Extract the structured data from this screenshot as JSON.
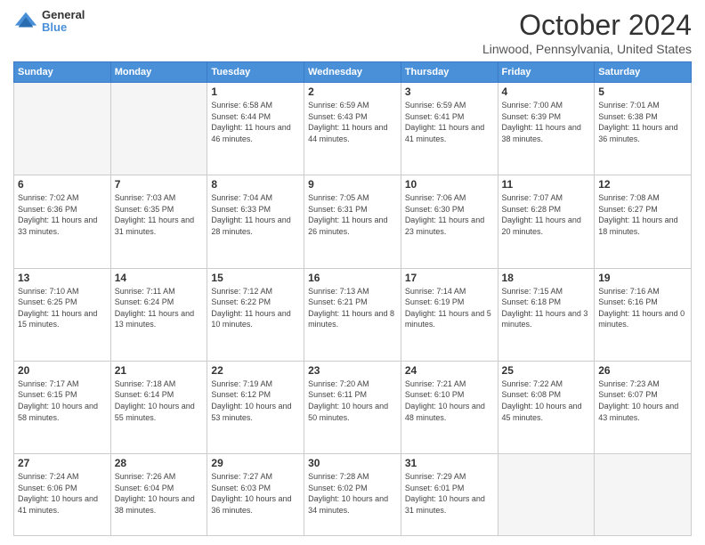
{
  "header": {
    "logo_general": "General",
    "logo_blue": "Blue",
    "title": "October 2024",
    "location": "Linwood, Pennsylvania, United States"
  },
  "weekdays": [
    "Sunday",
    "Monday",
    "Tuesday",
    "Wednesday",
    "Thursday",
    "Friday",
    "Saturday"
  ],
  "weeks": [
    [
      {
        "day": "",
        "sunrise": "",
        "sunset": "",
        "daylight": ""
      },
      {
        "day": "",
        "sunrise": "",
        "sunset": "",
        "daylight": ""
      },
      {
        "day": "1",
        "sunrise": "Sunrise: 6:58 AM",
        "sunset": "Sunset: 6:44 PM",
        "daylight": "Daylight: 11 hours and 46 minutes."
      },
      {
        "day": "2",
        "sunrise": "Sunrise: 6:59 AM",
        "sunset": "Sunset: 6:43 PM",
        "daylight": "Daylight: 11 hours and 44 minutes."
      },
      {
        "day": "3",
        "sunrise": "Sunrise: 6:59 AM",
        "sunset": "Sunset: 6:41 PM",
        "daylight": "Daylight: 11 hours and 41 minutes."
      },
      {
        "day": "4",
        "sunrise": "Sunrise: 7:00 AM",
        "sunset": "Sunset: 6:39 PM",
        "daylight": "Daylight: 11 hours and 38 minutes."
      },
      {
        "day": "5",
        "sunrise": "Sunrise: 7:01 AM",
        "sunset": "Sunset: 6:38 PM",
        "daylight": "Daylight: 11 hours and 36 minutes."
      }
    ],
    [
      {
        "day": "6",
        "sunrise": "Sunrise: 7:02 AM",
        "sunset": "Sunset: 6:36 PM",
        "daylight": "Daylight: 11 hours and 33 minutes."
      },
      {
        "day": "7",
        "sunrise": "Sunrise: 7:03 AM",
        "sunset": "Sunset: 6:35 PM",
        "daylight": "Daylight: 11 hours and 31 minutes."
      },
      {
        "day": "8",
        "sunrise": "Sunrise: 7:04 AM",
        "sunset": "Sunset: 6:33 PM",
        "daylight": "Daylight: 11 hours and 28 minutes."
      },
      {
        "day": "9",
        "sunrise": "Sunrise: 7:05 AM",
        "sunset": "Sunset: 6:31 PM",
        "daylight": "Daylight: 11 hours and 26 minutes."
      },
      {
        "day": "10",
        "sunrise": "Sunrise: 7:06 AM",
        "sunset": "Sunset: 6:30 PM",
        "daylight": "Daylight: 11 hours and 23 minutes."
      },
      {
        "day": "11",
        "sunrise": "Sunrise: 7:07 AM",
        "sunset": "Sunset: 6:28 PM",
        "daylight": "Daylight: 11 hours and 20 minutes."
      },
      {
        "day": "12",
        "sunrise": "Sunrise: 7:08 AM",
        "sunset": "Sunset: 6:27 PM",
        "daylight": "Daylight: 11 hours and 18 minutes."
      }
    ],
    [
      {
        "day": "13",
        "sunrise": "Sunrise: 7:10 AM",
        "sunset": "Sunset: 6:25 PM",
        "daylight": "Daylight: 11 hours and 15 minutes."
      },
      {
        "day": "14",
        "sunrise": "Sunrise: 7:11 AM",
        "sunset": "Sunset: 6:24 PM",
        "daylight": "Daylight: 11 hours and 13 minutes."
      },
      {
        "day": "15",
        "sunrise": "Sunrise: 7:12 AM",
        "sunset": "Sunset: 6:22 PM",
        "daylight": "Daylight: 11 hours and 10 minutes."
      },
      {
        "day": "16",
        "sunrise": "Sunrise: 7:13 AM",
        "sunset": "Sunset: 6:21 PM",
        "daylight": "Daylight: 11 hours and 8 minutes."
      },
      {
        "day": "17",
        "sunrise": "Sunrise: 7:14 AM",
        "sunset": "Sunset: 6:19 PM",
        "daylight": "Daylight: 11 hours and 5 minutes."
      },
      {
        "day": "18",
        "sunrise": "Sunrise: 7:15 AM",
        "sunset": "Sunset: 6:18 PM",
        "daylight": "Daylight: 11 hours and 3 minutes."
      },
      {
        "day": "19",
        "sunrise": "Sunrise: 7:16 AM",
        "sunset": "Sunset: 6:16 PM",
        "daylight": "Daylight: 11 hours and 0 minutes."
      }
    ],
    [
      {
        "day": "20",
        "sunrise": "Sunrise: 7:17 AM",
        "sunset": "Sunset: 6:15 PM",
        "daylight": "Daylight: 10 hours and 58 minutes."
      },
      {
        "day": "21",
        "sunrise": "Sunrise: 7:18 AM",
        "sunset": "Sunset: 6:14 PM",
        "daylight": "Daylight: 10 hours and 55 minutes."
      },
      {
        "day": "22",
        "sunrise": "Sunrise: 7:19 AM",
        "sunset": "Sunset: 6:12 PM",
        "daylight": "Daylight: 10 hours and 53 minutes."
      },
      {
        "day": "23",
        "sunrise": "Sunrise: 7:20 AM",
        "sunset": "Sunset: 6:11 PM",
        "daylight": "Daylight: 10 hours and 50 minutes."
      },
      {
        "day": "24",
        "sunrise": "Sunrise: 7:21 AM",
        "sunset": "Sunset: 6:10 PM",
        "daylight": "Daylight: 10 hours and 48 minutes."
      },
      {
        "day": "25",
        "sunrise": "Sunrise: 7:22 AM",
        "sunset": "Sunset: 6:08 PM",
        "daylight": "Daylight: 10 hours and 45 minutes."
      },
      {
        "day": "26",
        "sunrise": "Sunrise: 7:23 AM",
        "sunset": "Sunset: 6:07 PM",
        "daylight": "Daylight: 10 hours and 43 minutes."
      }
    ],
    [
      {
        "day": "27",
        "sunrise": "Sunrise: 7:24 AM",
        "sunset": "Sunset: 6:06 PM",
        "daylight": "Daylight: 10 hours and 41 minutes."
      },
      {
        "day": "28",
        "sunrise": "Sunrise: 7:26 AM",
        "sunset": "Sunset: 6:04 PM",
        "daylight": "Daylight: 10 hours and 38 minutes."
      },
      {
        "day": "29",
        "sunrise": "Sunrise: 7:27 AM",
        "sunset": "Sunset: 6:03 PM",
        "daylight": "Daylight: 10 hours and 36 minutes."
      },
      {
        "day": "30",
        "sunrise": "Sunrise: 7:28 AM",
        "sunset": "Sunset: 6:02 PM",
        "daylight": "Daylight: 10 hours and 34 minutes."
      },
      {
        "day": "31",
        "sunrise": "Sunrise: 7:29 AM",
        "sunset": "Sunset: 6:01 PM",
        "daylight": "Daylight: 10 hours and 31 minutes."
      },
      {
        "day": "",
        "sunrise": "",
        "sunset": "",
        "daylight": ""
      },
      {
        "day": "",
        "sunrise": "",
        "sunset": "",
        "daylight": ""
      }
    ]
  ]
}
